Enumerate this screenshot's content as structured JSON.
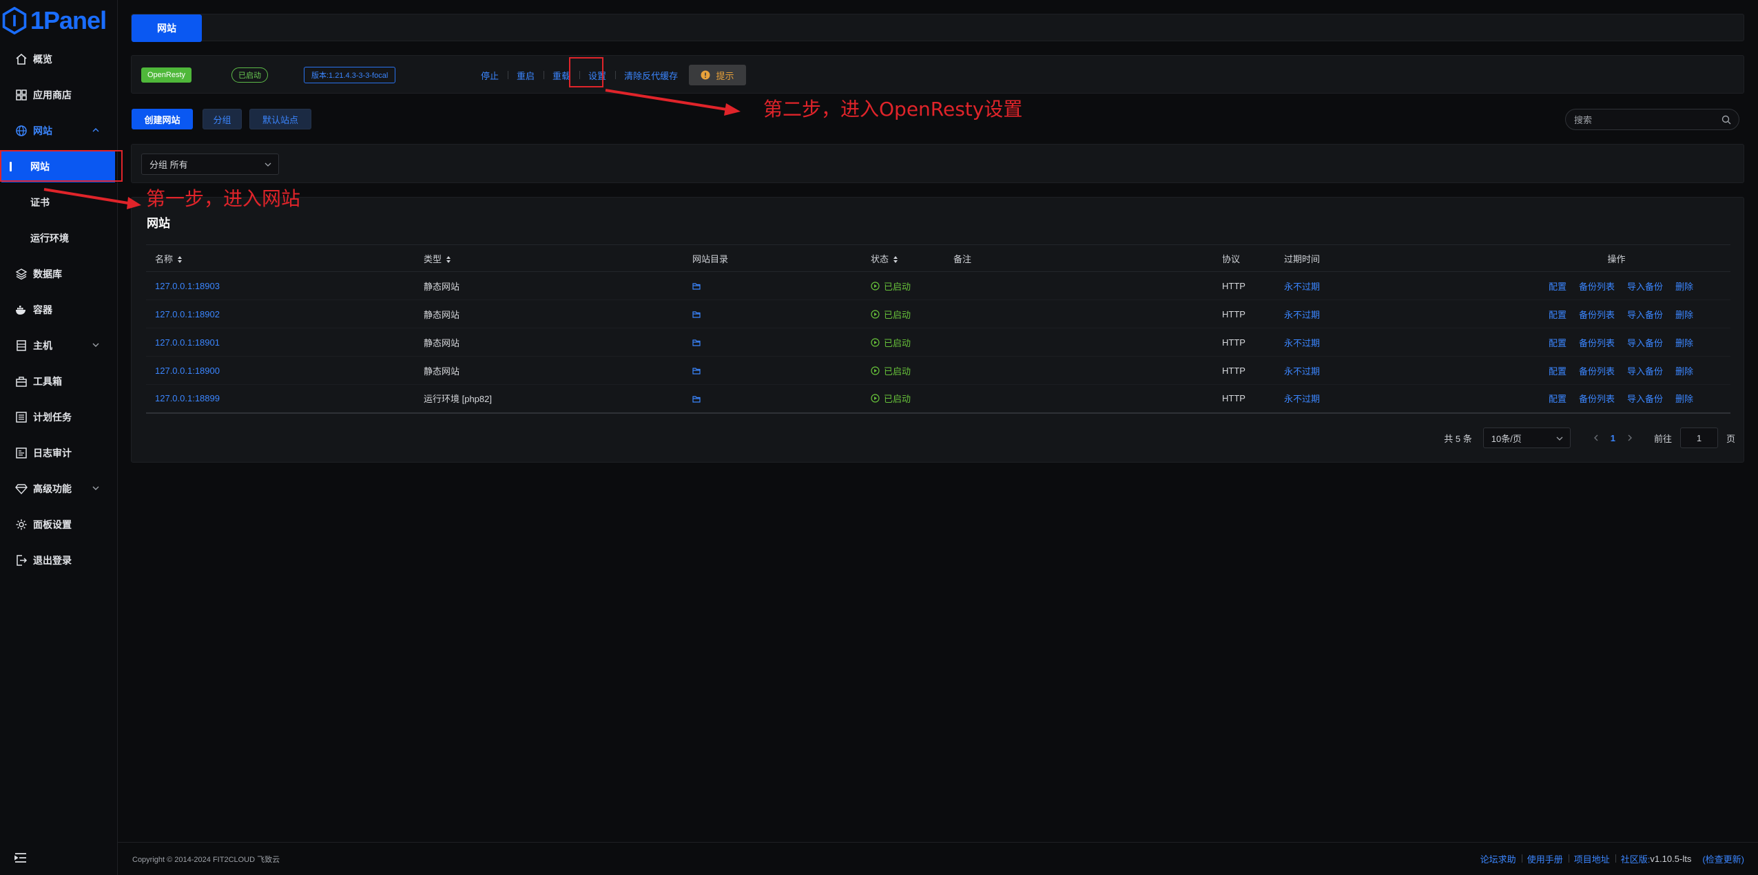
{
  "app": {
    "logo_text": "1Panel"
  },
  "sidebar": {
    "items": [
      {
        "label": "概览",
        "icon": "home-icon"
      },
      {
        "label": "应用商店",
        "icon": "app-grid-icon"
      },
      {
        "label": "网站",
        "icon": "globe-icon",
        "open": true,
        "children": [
          {
            "label": "网站",
            "active": true
          },
          {
            "label": "证书"
          },
          {
            "label": "运行环境"
          }
        ]
      },
      {
        "label": "数据库",
        "icon": "layers-icon"
      },
      {
        "label": "容器",
        "icon": "docker-icon"
      },
      {
        "label": "主机",
        "icon": "server-icon",
        "expandable": true
      },
      {
        "label": "工具箱",
        "icon": "toolbox-icon"
      },
      {
        "label": "计划任务",
        "icon": "list-icon"
      },
      {
        "label": "日志审计",
        "icon": "log-icon"
      },
      {
        "label": "高级功能",
        "icon": "diamond-icon",
        "expandable": true
      },
      {
        "label": "面板设置",
        "icon": "gear-icon"
      },
      {
        "label": "退出登录",
        "icon": "logout-icon"
      }
    ]
  },
  "tabs": {
    "active": "网站"
  },
  "appbar": {
    "app_name": "OpenResty",
    "status": "已启动",
    "version": "版本:1.21.4.3-3-3-focal",
    "actions": [
      "停止",
      "重启",
      "重载",
      "设置",
      "清除反代缓存"
    ],
    "hint": "提示"
  },
  "actions": {
    "create": "创建网站",
    "group": "分组",
    "default_site": "默认站点",
    "search_placeholder": "搜索"
  },
  "filter": {
    "group_label": "分组",
    "group_value": "所有"
  },
  "table": {
    "title": "网站",
    "headers": {
      "name": "名称",
      "type": "类型",
      "dir": "网站目录",
      "status": "状态",
      "remark": "备注",
      "protocol": "协议",
      "expire": "过期时间",
      "ops": "操作"
    },
    "rows": [
      {
        "name": "127.0.0.1:18903",
        "type": "静态网站",
        "status": "已启动",
        "protocol": "HTTP",
        "expire": "永不过期"
      },
      {
        "name": "127.0.0.1:18902",
        "type": "静态网站",
        "status": "已启动",
        "protocol": "HTTP",
        "expire": "永不过期"
      },
      {
        "name": "127.0.0.1:18901",
        "type": "静态网站",
        "status": "已启动",
        "protocol": "HTTP",
        "expire": "永不过期"
      },
      {
        "name": "127.0.0.1:18900",
        "type": "静态网站",
        "status": "已启动",
        "protocol": "HTTP",
        "expire": "永不过期"
      },
      {
        "name": "127.0.0.1:18899",
        "type": "运行环境 [php82]",
        "status": "已启动",
        "protocol": "HTTP",
        "expire": "永不过期"
      }
    ],
    "row_ops": [
      "配置",
      "备份列表",
      "导入备份",
      "删除"
    ]
  },
  "pagination": {
    "total": "共 5 条",
    "page_size": "10条/页",
    "current_page": "1",
    "goto_label": "前往",
    "goto_value": "1",
    "page_suffix": "页"
  },
  "footer": {
    "copyright": "Copyright © 2014-2024 FIT2CLOUD 飞致云",
    "links": [
      "论坛求助",
      "使用手册",
      "项目地址"
    ],
    "version_label": "社区版:",
    "version": "v1.10.5-lts",
    "check_update": "(检查更新)"
  },
  "annotations": {
    "step1": "第一步，进入网站",
    "step2": "第二步，进入OpenResty设置"
  },
  "colors": {
    "accent": "#0a58f2",
    "link": "#3b86ff",
    "success": "#67c23a",
    "annotation": "#e0242a",
    "background": "#0b0c0e"
  }
}
